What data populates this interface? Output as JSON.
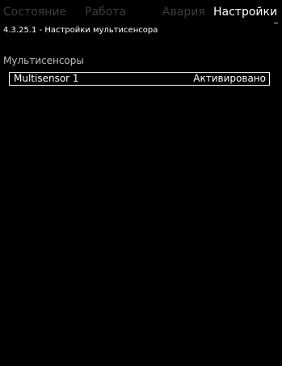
{
  "tabs": [
    {
      "label": "Состояние",
      "active": false
    },
    {
      "label": "Работа",
      "active": false
    },
    {
      "label": "Авария",
      "active": false
    },
    {
      "label": "Настройки",
      "active": true
    }
  ],
  "page": {
    "title": "4.3.25.1 - Настройки мультисенсора"
  },
  "section": {
    "title": "Мультисенсоры"
  },
  "items": [
    {
      "name": "Multisensor 1",
      "status": "Активировано"
    }
  ],
  "colors": {
    "background": "#000000",
    "active_text": "#ffffff",
    "inactive_tab": "#3c3c3c",
    "section_text": "#bdbdbd"
  }
}
